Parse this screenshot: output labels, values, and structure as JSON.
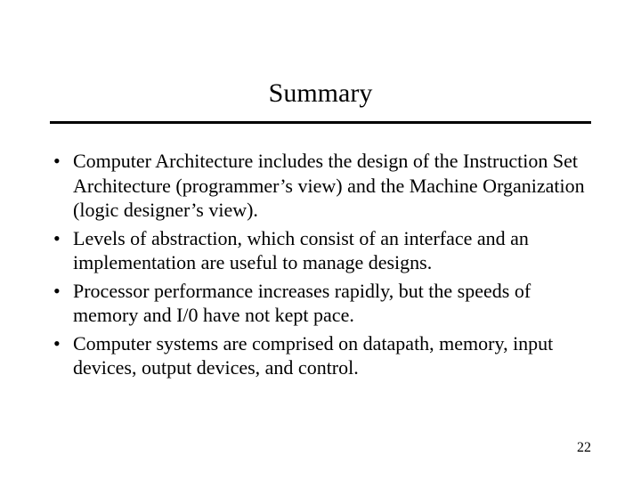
{
  "title": "Summary",
  "bullets": [
    "Computer Architecture includes the design of the Instruction Set Architecture (programmer’s view) and the Machine Organization (logic designer’s view).",
    "Levels of abstraction, which consist of an interface and an implementation are useful to manage designs.",
    "Processor performance increases rapidly, but the speeds of memory and I/0 have not kept pace.",
    "Computer systems are comprised on datapath, memory, input devices, output devices, and control."
  ],
  "page_number": "22"
}
